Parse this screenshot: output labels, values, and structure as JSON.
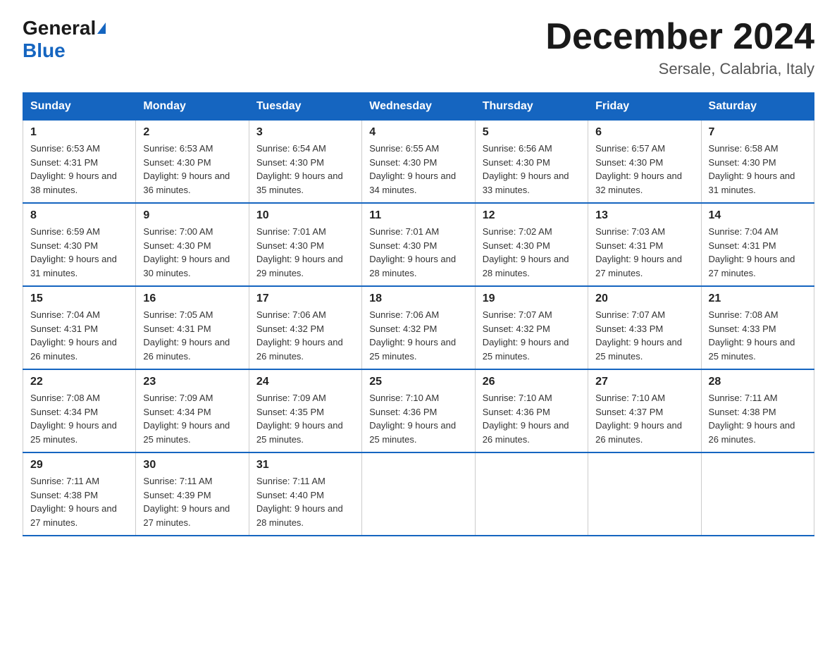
{
  "logo": {
    "general": "General",
    "blue": "Blue",
    "triangle": "▶"
  },
  "header": {
    "title": "December 2024",
    "subtitle": "Sersale, Calabria, Italy"
  },
  "days_of_week": [
    "Sunday",
    "Monday",
    "Tuesday",
    "Wednesday",
    "Thursday",
    "Friday",
    "Saturday"
  ],
  "weeks": [
    [
      {
        "day": "1",
        "sunrise": "6:53 AM",
        "sunset": "4:31 PM",
        "daylight": "9 hours and 38 minutes."
      },
      {
        "day": "2",
        "sunrise": "6:53 AM",
        "sunset": "4:30 PM",
        "daylight": "9 hours and 36 minutes."
      },
      {
        "day": "3",
        "sunrise": "6:54 AM",
        "sunset": "4:30 PM",
        "daylight": "9 hours and 35 minutes."
      },
      {
        "day": "4",
        "sunrise": "6:55 AM",
        "sunset": "4:30 PM",
        "daylight": "9 hours and 34 minutes."
      },
      {
        "day": "5",
        "sunrise": "6:56 AM",
        "sunset": "4:30 PM",
        "daylight": "9 hours and 33 minutes."
      },
      {
        "day": "6",
        "sunrise": "6:57 AM",
        "sunset": "4:30 PM",
        "daylight": "9 hours and 32 minutes."
      },
      {
        "day": "7",
        "sunrise": "6:58 AM",
        "sunset": "4:30 PM",
        "daylight": "9 hours and 31 minutes."
      }
    ],
    [
      {
        "day": "8",
        "sunrise": "6:59 AM",
        "sunset": "4:30 PM",
        "daylight": "9 hours and 31 minutes."
      },
      {
        "day": "9",
        "sunrise": "7:00 AM",
        "sunset": "4:30 PM",
        "daylight": "9 hours and 30 minutes."
      },
      {
        "day": "10",
        "sunrise": "7:01 AM",
        "sunset": "4:30 PM",
        "daylight": "9 hours and 29 minutes."
      },
      {
        "day": "11",
        "sunrise": "7:01 AM",
        "sunset": "4:30 PM",
        "daylight": "9 hours and 28 minutes."
      },
      {
        "day": "12",
        "sunrise": "7:02 AM",
        "sunset": "4:30 PM",
        "daylight": "9 hours and 28 minutes."
      },
      {
        "day": "13",
        "sunrise": "7:03 AM",
        "sunset": "4:31 PM",
        "daylight": "9 hours and 27 minutes."
      },
      {
        "day": "14",
        "sunrise": "7:04 AM",
        "sunset": "4:31 PM",
        "daylight": "9 hours and 27 minutes."
      }
    ],
    [
      {
        "day": "15",
        "sunrise": "7:04 AM",
        "sunset": "4:31 PM",
        "daylight": "9 hours and 26 minutes."
      },
      {
        "day": "16",
        "sunrise": "7:05 AM",
        "sunset": "4:31 PM",
        "daylight": "9 hours and 26 minutes."
      },
      {
        "day": "17",
        "sunrise": "7:06 AM",
        "sunset": "4:32 PM",
        "daylight": "9 hours and 26 minutes."
      },
      {
        "day": "18",
        "sunrise": "7:06 AM",
        "sunset": "4:32 PM",
        "daylight": "9 hours and 25 minutes."
      },
      {
        "day": "19",
        "sunrise": "7:07 AM",
        "sunset": "4:32 PM",
        "daylight": "9 hours and 25 minutes."
      },
      {
        "day": "20",
        "sunrise": "7:07 AM",
        "sunset": "4:33 PM",
        "daylight": "9 hours and 25 minutes."
      },
      {
        "day": "21",
        "sunrise": "7:08 AM",
        "sunset": "4:33 PM",
        "daylight": "9 hours and 25 minutes."
      }
    ],
    [
      {
        "day": "22",
        "sunrise": "7:08 AM",
        "sunset": "4:34 PM",
        "daylight": "9 hours and 25 minutes."
      },
      {
        "day": "23",
        "sunrise": "7:09 AM",
        "sunset": "4:34 PM",
        "daylight": "9 hours and 25 minutes."
      },
      {
        "day": "24",
        "sunrise": "7:09 AM",
        "sunset": "4:35 PM",
        "daylight": "9 hours and 25 minutes."
      },
      {
        "day": "25",
        "sunrise": "7:10 AM",
        "sunset": "4:36 PM",
        "daylight": "9 hours and 25 minutes."
      },
      {
        "day": "26",
        "sunrise": "7:10 AM",
        "sunset": "4:36 PM",
        "daylight": "9 hours and 26 minutes."
      },
      {
        "day": "27",
        "sunrise": "7:10 AM",
        "sunset": "4:37 PM",
        "daylight": "9 hours and 26 minutes."
      },
      {
        "day": "28",
        "sunrise": "7:11 AM",
        "sunset": "4:38 PM",
        "daylight": "9 hours and 26 minutes."
      }
    ],
    [
      {
        "day": "29",
        "sunrise": "7:11 AM",
        "sunset": "4:38 PM",
        "daylight": "9 hours and 27 minutes."
      },
      {
        "day": "30",
        "sunrise": "7:11 AM",
        "sunset": "4:39 PM",
        "daylight": "9 hours and 27 minutes."
      },
      {
        "day": "31",
        "sunrise": "7:11 AM",
        "sunset": "4:40 PM",
        "daylight": "9 hours and 28 minutes."
      },
      null,
      null,
      null,
      null
    ]
  ]
}
